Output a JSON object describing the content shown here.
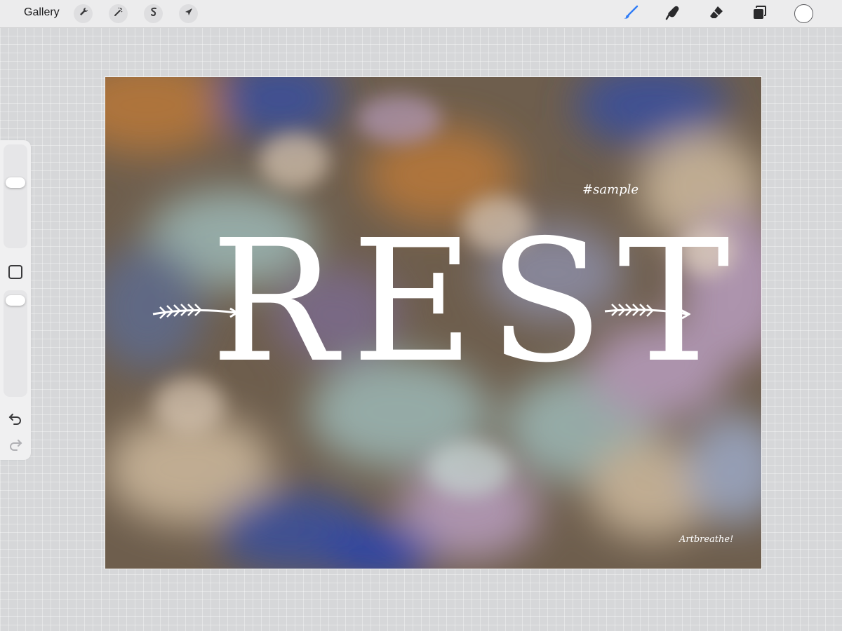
{
  "topbar": {
    "gallery_label": "Gallery",
    "left_tools": [
      "actions-icon",
      "adjustments-icon",
      "selection-icon",
      "transform-icon"
    ],
    "right_tools": [
      "brush-icon",
      "smudge-icon",
      "eraser-icon",
      "layers-icon"
    ],
    "active_tool": "brush-icon",
    "active_color": "#ffffff",
    "accent_color": "#2f7cf6"
  },
  "sidebar": {
    "brush_size_level": 0.65,
    "opacity_level": 0.95,
    "controls": [
      "brush-size-slider",
      "modify-button",
      "opacity-slider",
      "undo-icon",
      "redo-icon"
    ]
  },
  "canvas": {
    "title": "REST",
    "tag": "#sample",
    "signature": "Artbreathe!",
    "palette": [
      "#6b5a4a",
      "#3b4f9a",
      "#b5773a",
      "#9ab3b0",
      "#b49ab8",
      "#c9b59a"
    ]
  }
}
